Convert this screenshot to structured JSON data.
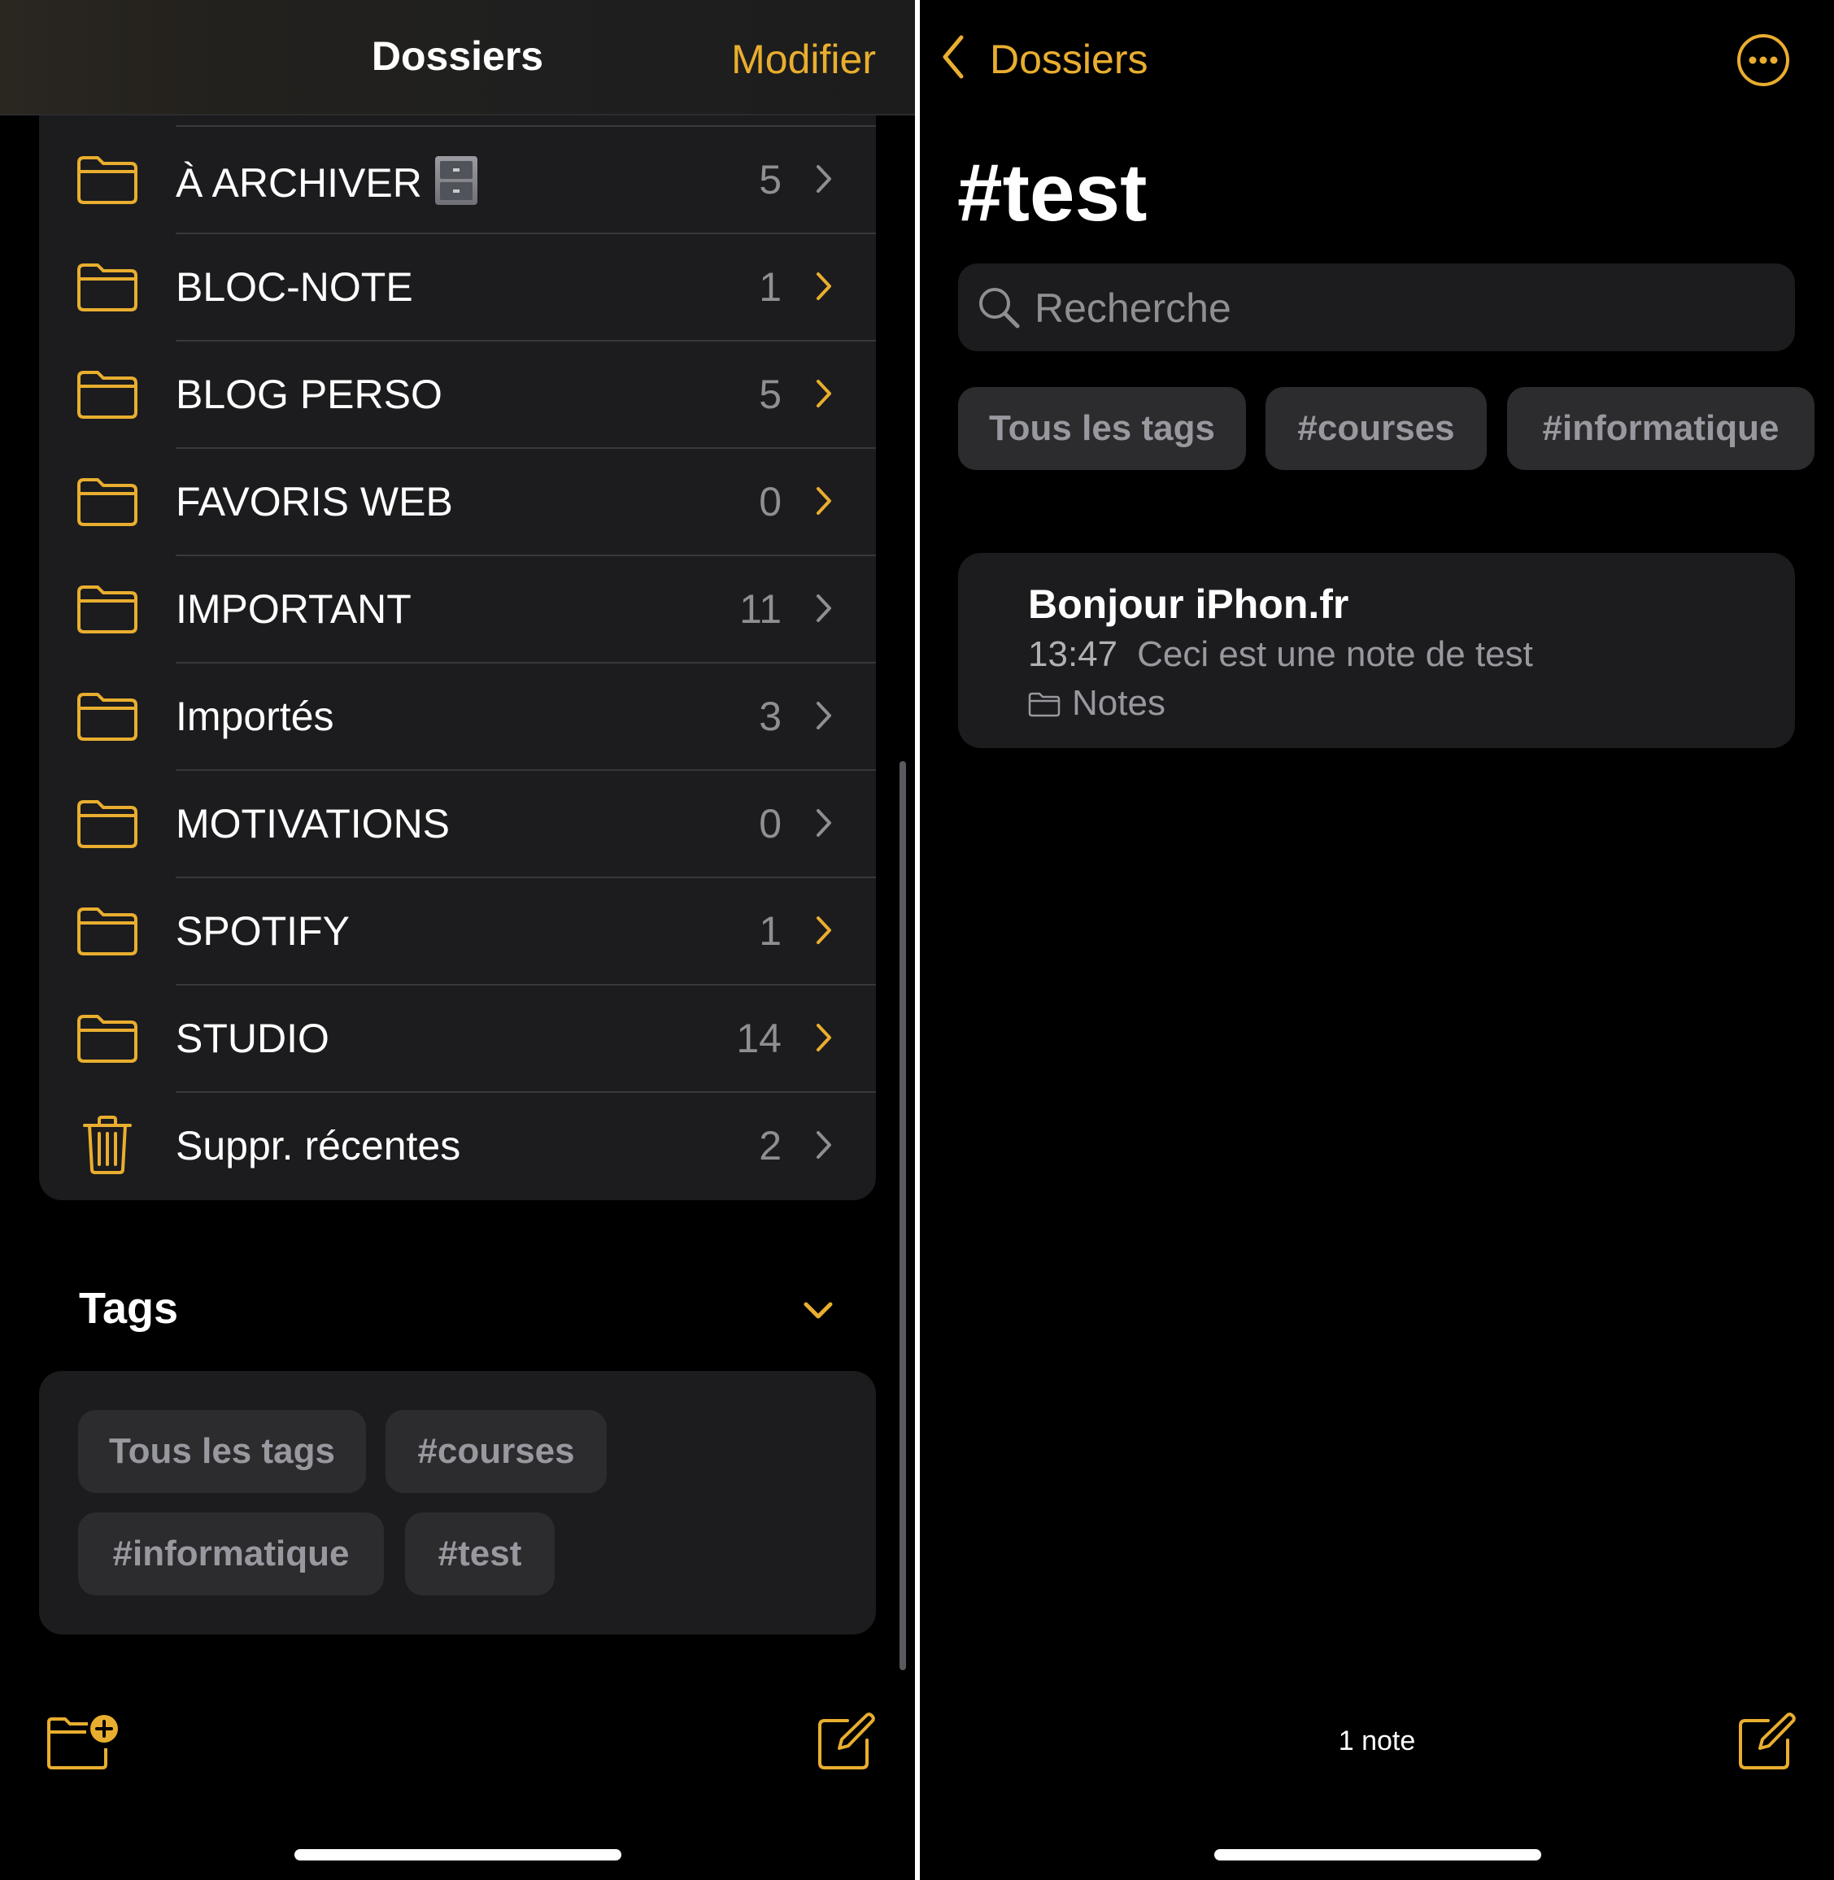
{
  "left": {
    "header": {
      "title": "Dossiers",
      "edit_label": "Modifier"
    },
    "folders": [
      {
        "name": "À ARCHIVER",
        "count": "5",
        "icon": "folder-icon",
        "emoji": "card-file-cabinet"
      },
      {
        "name": "BLOC-NOTE",
        "count": "1",
        "icon": "folder-icon"
      },
      {
        "name": "BLOG PERSO",
        "count": "5",
        "icon": "folder-icon"
      },
      {
        "name": "FAVORIS WEB",
        "count": "0",
        "icon": "folder-icon"
      },
      {
        "name": "IMPORTANT",
        "count": "11",
        "icon": "folder-icon"
      },
      {
        "name": "Importés",
        "count": "3",
        "icon": "folder-icon"
      },
      {
        "name": "MOTIVATIONS",
        "count": "0",
        "icon": "folder-icon"
      },
      {
        "name": "SPOTIFY",
        "count": "1",
        "icon": "folder-icon"
      },
      {
        "name": "STUDIO",
        "count": "14",
        "icon": "folder-icon"
      },
      {
        "name": "Suppr. récentes",
        "count": "2",
        "icon": "trash-icon"
      }
    ],
    "tags": {
      "heading": "Tags",
      "chips": [
        "Tous les tags",
        "#courses",
        "#informatique",
        "#test"
      ]
    }
  },
  "right": {
    "back_label": "Dossiers",
    "title": "#test",
    "search_placeholder": "Recherche",
    "tag_chips": [
      "Tous les tags",
      "#courses",
      "#informatique"
    ],
    "note": {
      "title": "Bonjour iPhon.fr",
      "time": "13:47",
      "preview": "Ceci est une note de test",
      "folder": "Notes"
    },
    "note_count": "1 note"
  },
  "colors": {
    "accent": "#e9ae2f",
    "background": "#000000",
    "card": "#1c1c1e",
    "chip": "#2c2c2e",
    "secondary_text": "#8e8e93",
    "chevron_dim": "#8e8e93"
  }
}
